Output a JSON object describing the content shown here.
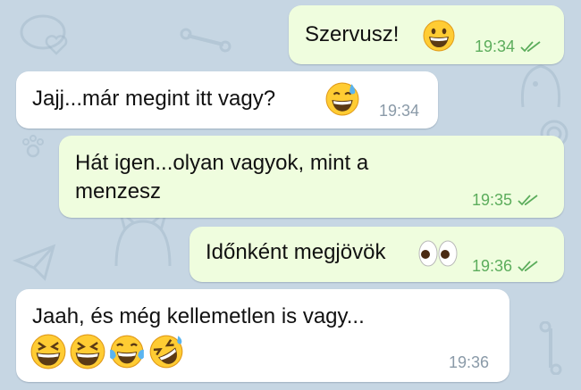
{
  "colors": {
    "wallpaper": "#c6d6e3",
    "outgoing_bubble": "#effdde",
    "incoming_bubble": "#ffffff",
    "outgoing_meta": "#5cad5c",
    "incoming_meta": "#8a9aa8"
  },
  "messages": [
    {
      "direction": "outgoing",
      "text": "Szervusz!",
      "emoji": [
        "grinning-face"
      ],
      "time": "19:34",
      "status_icon": "double-check-icon"
    },
    {
      "direction": "incoming",
      "text": "Jajj...már megint itt vagy?",
      "emoji": [
        "grinning-face-with-sweat"
      ],
      "time": "19:34"
    },
    {
      "direction": "outgoing",
      "text_lines": [
        "Hát igen...olyan vagyok, mint a",
        "menzesz"
      ],
      "time": "19:35",
      "status_icon": "double-check-icon"
    },
    {
      "direction": "outgoing",
      "text": "Időnként megjövök",
      "emoji": [
        "eyes"
      ],
      "time": "19:36",
      "status_icon": "double-check-icon"
    },
    {
      "direction": "incoming",
      "text": "Jaah, és még kellemetlen is vagy...",
      "emoji": [
        "grinning-squinting-face",
        "grinning-squinting-face",
        "face-with-tears-of-joy",
        "rolling-on-the-floor-laughing"
      ],
      "time": "19:36"
    }
  ]
}
